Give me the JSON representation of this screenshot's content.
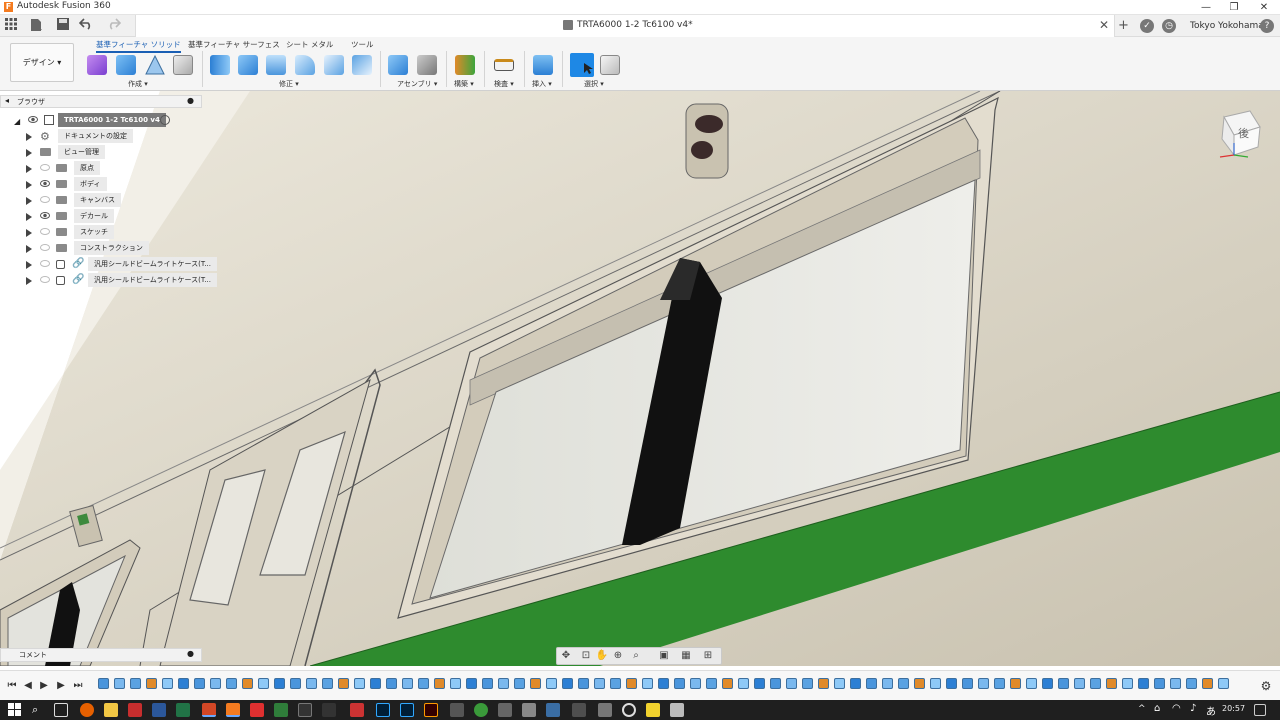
{
  "app": {
    "title": "Autodesk Fusion 360",
    "logo_letter": "F",
    "window_controls": [
      "—",
      "❐",
      "✕"
    ]
  },
  "quick_access": {
    "icons": [
      "grid-icon",
      "file-icon",
      "save-icon",
      "undo-icon",
      "redo-icon"
    ]
  },
  "document_tab": {
    "title": "TRTA6000 1-2 Tc6100 v4*",
    "close": "✕"
  },
  "header_right": {
    "add": "+",
    "user_location": "Tokyo Yokohama",
    "help": "?"
  },
  "ribbon": {
    "workspace_button": "デザイン ▾",
    "tabs": [
      "基準フィーチャ ソリッド",
      "基準フィーチャ サーフェス",
      "シート メタル",
      "ツール"
    ],
    "active_tab_index": 0,
    "groups": [
      "作成 ▾",
      "修正 ▾",
      "アセンブリ ▾",
      "構築 ▾",
      "検査 ▾",
      "挿入 ▾",
      "選択 ▾"
    ]
  },
  "browser": {
    "header": "ブラウザ",
    "root": "TRTA6000 1-2 Tc6100 v4",
    "items": [
      {
        "label": "ドキュメントの設定",
        "icon": "gear-icon",
        "eye": false
      },
      {
        "label": "ビュー管理",
        "icon": "folder-icon",
        "eye": false
      },
      {
        "label": "原点",
        "icon": "folder-icon",
        "eye": true,
        "visible": false
      },
      {
        "label": "ボディ",
        "icon": "folder-icon",
        "eye": true,
        "visible": true
      },
      {
        "label": "キャンバス",
        "icon": "folder-icon",
        "eye": true,
        "visible": false
      },
      {
        "label": "デカール",
        "icon": "folder-icon",
        "eye": true,
        "visible": true
      },
      {
        "label": "スケッチ",
        "icon": "folder-icon",
        "eye": true,
        "visible": false
      },
      {
        "label": "コンストラクション",
        "icon": "folder-icon",
        "eye": true,
        "visible": false
      },
      {
        "label": "汎用シールドビームライトケース(T...",
        "icon": "link-icon",
        "eye": true,
        "visible": false
      },
      {
        "label": "汎用シールドビームライトケース(T...",
        "icon": "link-icon",
        "eye": true,
        "visible": false
      }
    ]
  },
  "comments": {
    "label": "コメント"
  },
  "viewcube": {
    "face_label": "後"
  },
  "taskbar": {
    "time": "20:57",
    "tray": "^"
  },
  "colors": {
    "train_body": "#d9d3c4",
    "green_stripe": "#2e8b2e",
    "window_glass": "#e7e7e1",
    "active_tab": "#1a5fb4",
    "taskbar": "#1f1f1f"
  }
}
